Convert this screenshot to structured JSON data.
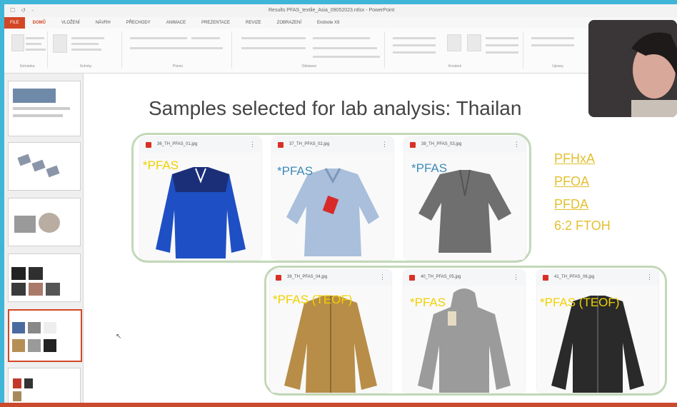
{
  "window": {
    "title": "Results PFAS_textile_Asia_09052023.ntlsx - PowerPoint",
    "qat": "☐ ↺ -"
  },
  "ribbon_tabs": [
    "FILE",
    "DOMŮ",
    "VLOŽENÍ",
    "NÁVRH",
    "PŘECHODY",
    "ANIMACE",
    "PREZENTACE",
    "REVIZE",
    "ZOBRAZENÍ",
    "Endnote X9"
  ],
  "ribbon_groups": [
    "Schránka",
    "Snímky",
    "Písmo",
    "Odstavec",
    "Kreslení",
    "Úpravy"
  ],
  "slide": {
    "title": "Samples selected for lab analysis: Thailan",
    "files_top": [
      {
        "name": "36_TH_PFAS_01.jpg",
        "label": "*PFAS",
        "garment": "blue-jacket"
      },
      {
        "name": "37_TH_PFAS_02.jpg",
        "label": "*PFAS",
        "garment": "light-blue-shirt"
      },
      {
        "name": "38_TH_PFAS_03.jpg",
        "label": "*PFAS",
        "garment": "grey-shirt"
      }
    ],
    "files_bottom": [
      {
        "name": "39_TH_PFAS_04.jpg",
        "label": "*PFAS (TEOF)",
        "garment": "khaki-jacket"
      },
      {
        "name": "40_TH_PFAS_05.jpg",
        "label": "*PFAS",
        "garment": "grey-hoodie"
      },
      {
        "name": "41_TH_PFAS_06.jpg",
        "label": "*PFAS (TEOF)",
        "garment": "black-jacket"
      }
    ],
    "chemicals": [
      "PFHxA",
      "PFOA",
      "PFDA",
      "6:2 FTOH"
    ]
  },
  "colors": {
    "accent": "#d24726",
    "label_yellow": "#f0d100",
    "label_blue": "#3d8ab9",
    "chem": "#e3bf2e",
    "group_border": "#c3d8b8"
  }
}
